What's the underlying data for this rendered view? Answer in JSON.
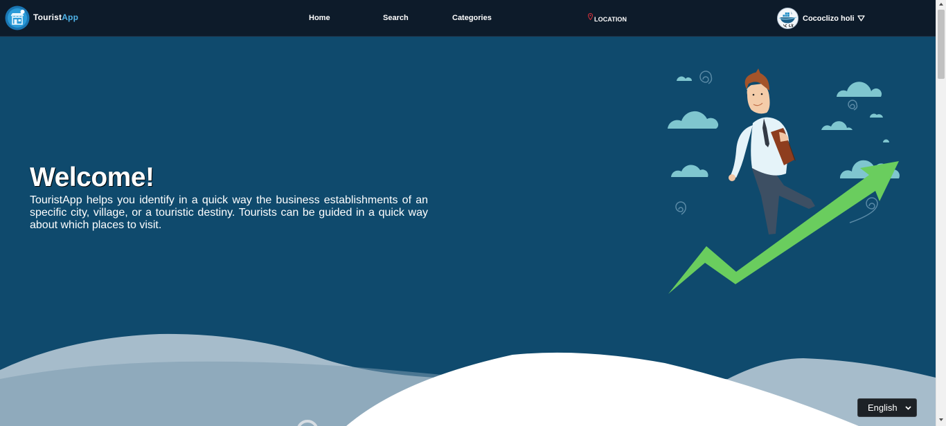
{
  "brand": {
    "name_part1": "Tourist",
    "name_part2": "App",
    "logo_icon": "shop-logo-icon",
    "accent_color": "#4fb3e8"
  },
  "nav": {
    "home_label": "Home",
    "search_label": "Search",
    "categories_label": "Categories",
    "location_label": "LOCATION",
    "location_icon": "map-pin-icon"
  },
  "user": {
    "name": "Cococlizo holi",
    "avatar_icon": "docker-avatar-icon",
    "caret_icon": "caret-down-icon"
  },
  "hero": {
    "title": "Welcome!",
    "description": "TouristApp helps you identify in a quick way the business establishments of an specific city, village, or a touristic destiny. Tourists can be guided in a quick way about which places to visit.",
    "illustration": "businessman-growth-arrow-illustration",
    "background_color": "#0f4a6d"
  },
  "language": {
    "selected": "English",
    "icon": "chevron-down-icon"
  },
  "colors": {
    "navbar": "#0d1b2a",
    "hero": "#0f4a6d",
    "wave_light": "#a6bccb",
    "arrow": "#6acd5e",
    "cloud": "#7fc6cf"
  }
}
